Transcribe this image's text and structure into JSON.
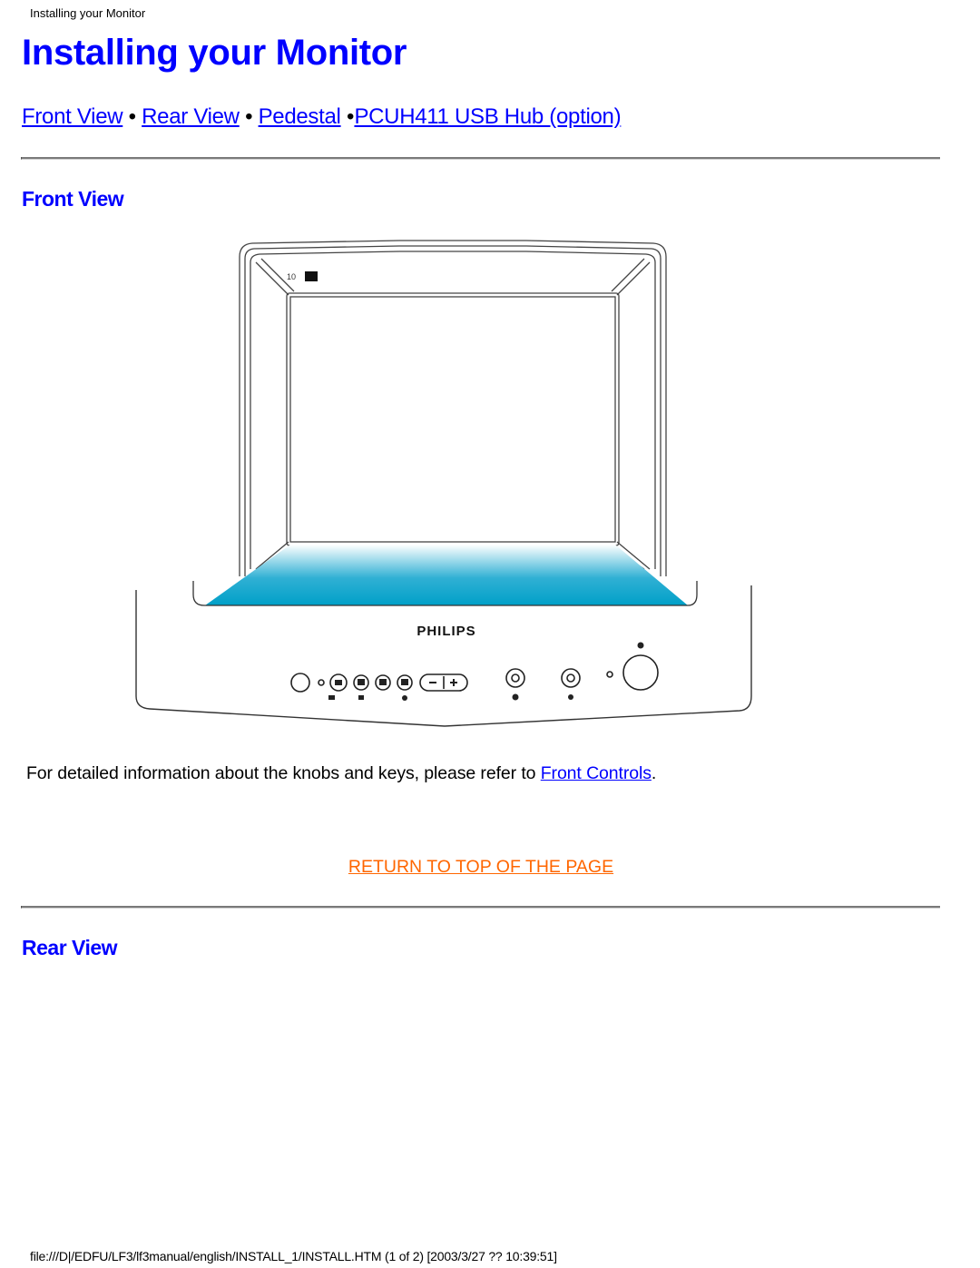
{
  "page_header": "Installing your Monitor",
  "title": "Installing your Monitor",
  "nav": {
    "links": [
      {
        "label": "Front View"
      },
      {
        "label": "Rear View"
      },
      {
        "label": "Pedestal"
      },
      {
        "label": "PCUH411 USB Hub (option)"
      }
    ],
    "separator": "•"
  },
  "sections": {
    "front_view": {
      "heading": "Front View",
      "image": {
        "brand_label": "PHILIPS",
        "corner_label": "10",
        "screen_gradient_colors": [
          "#ffffff",
          "#00a0c8"
        ]
      },
      "description_prefix": "For detailed information about the knobs and keys, please refer to ",
      "description_link": "Front Controls",
      "description_suffix": ".",
      "return_link": "RETURN TO TOP OF THE PAGE"
    },
    "rear_view": {
      "heading": "Rear View"
    }
  },
  "footer": "file:///D|/EDFU/LF3/lf3manual/english/INSTALL_1/INSTALL.HTM (1 of 2) [2003/3/27 ?? 10:39:51]",
  "colors": {
    "link": "#0000ff",
    "heading": "#0000ff",
    "return_link": "#ff6600",
    "text": "#000000"
  }
}
